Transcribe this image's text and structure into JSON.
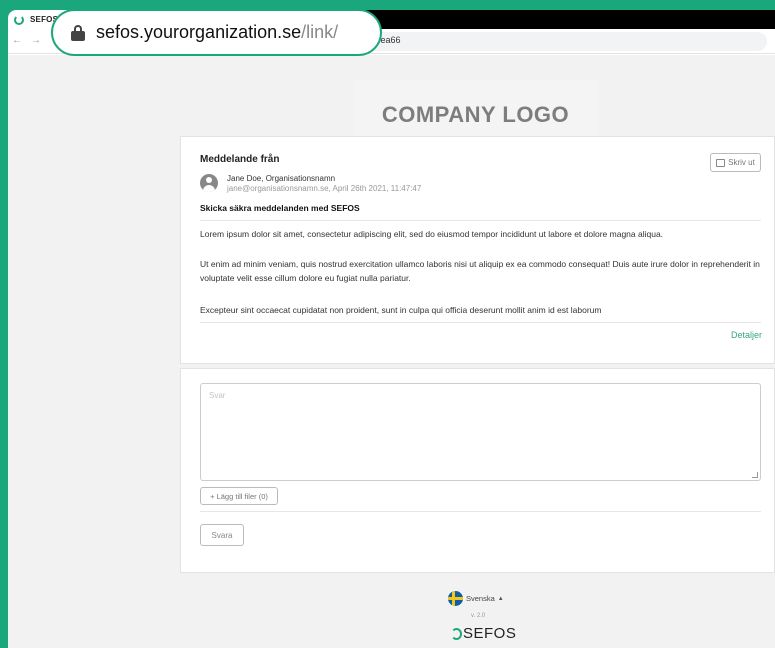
{
  "browser": {
    "tab_title": "SEFOS",
    "tab_close": "×",
    "nav_back": "←",
    "nav_forward": "→",
    "url_host": "sefos.yourorganization.se",
    "url_path": "/link/",
    "url_tail": "fea66"
  },
  "header": {
    "logo_text": "COMPANY LOGO"
  },
  "message": {
    "heading": "Meddelande från",
    "print_label": "Skriv ut",
    "sender_name": "Jane Doe, Organisationsnamn",
    "sender_meta": "jane@organisationsnamn.se, April 26th 2021, 11:47:47",
    "subject": "Skicka säkra meddelanden med SEFOS",
    "paragraphs": [
      "Lorem ipsum dolor sit amet, consectetur adipiscing elit, sed do eiusmod tempor incididunt ut labore et dolore magna aliqua.",
      "Ut enim ad minim veniam, quis nostrud exercitation ullamco laboris nisi ut aliquip ex ea commodo consequat! Duis aute irure dolor in reprehenderit in voluptate velit esse cillum dolore eu fugiat nulla pariatur.",
      "Excepteur sint occaecat cupidatat non proident, sunt in culpa qui officia deserunt mollit anim id est laborum"
    ],
    "details_link": "Detaljer"
  },
  "reply": {
    "placeholder": "Svar",
    "add_files_label": "+ Lägg till filer (0)",
    "send_label": "Svara"
  },
  "footer": {
    "language": "Svenska",
    "language_caret": "▲",
    "version": "v. 2.0",
    "brand": "SEFOS"
  },
  "colors": {
    "accent": "#1ba77c",
    "link": "#3aa386"
  }
}
